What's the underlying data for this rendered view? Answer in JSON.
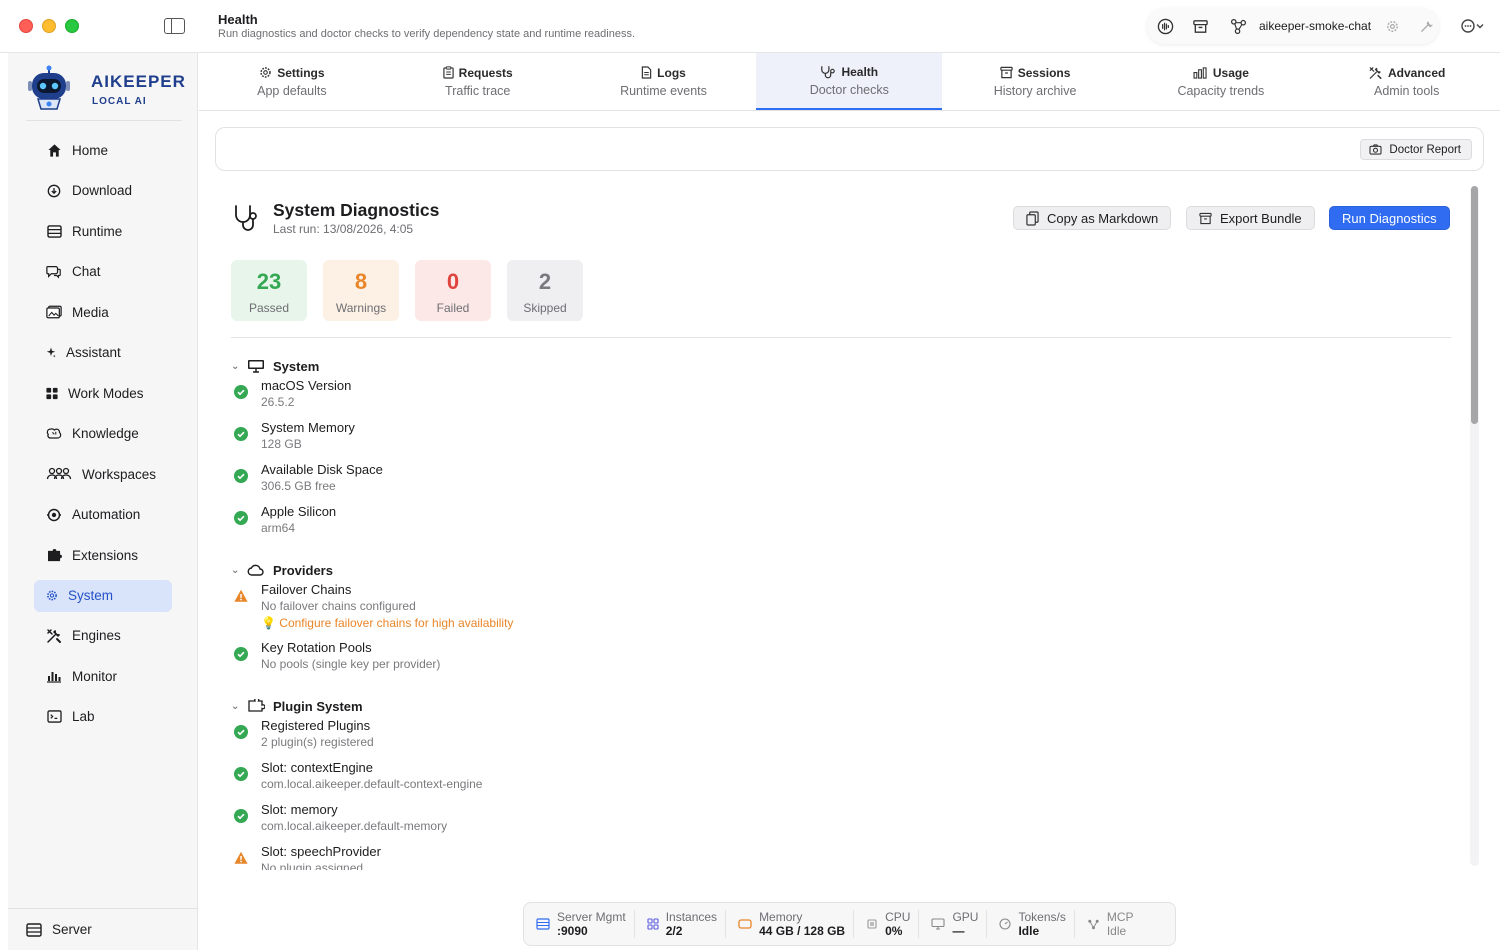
{
  "window": {
    "title": "Health",
    "subtitle": "Run diagnostics and doctor checks to verify dependency state and runtime readiness."
  },
  "toolbar": {
    "model_name": "aikeeper-smoke-chat"
  },
  "brand": {
    "name": "AIKEEPER",
    "sub": "LOCAL AI"
  },
  "sidebar": {
    "items": [
      {
        "label": "Home",
        "icon": "home-icon"
      },
      {
        "label": "Download",
        "icon": "download-icon"
      },
      {
        "label": "Runtime",
        "icon": "runtime-icon"
      },
      {
        "label": "Chat",
        "icon": "chat-icon"
      },
      {
        "label": "Media",
        "icon": "media-icon"
      },
      {
        "label": "Assistant",
        "icon": "sparkle-icon"
      },
      {
        "label": "Work Modes",
        "icon": "grid-icon"
      },
      {
        "label": "Knowledge",
        "icon": "brain-icon"
      },
      {
        "label": "Workspaces",
        "icon": "people-icon"
      },
      {
        "label": "Automation",
        "icon": "automation-icon"
      },
      {
        "label": "Extensions",
        "icon": "puzzle-icon"
      },
      {
        "label": "System",
        "icon": "gear-icon"
      },
      {
        "label": "Engines",
        "icon": "wrench-icon"
      },
      {
        "label": "Monitor",
        "icon": "chart-icon"
      },
      {
        "label": "Lab",
        "icon": "terminal-icon"
      }
    ],
    "active": "System",
    "footer_label": "Server"
  },
  "tabs": [
    {
      "label": "Settings",
      "sub": "App defaults",
      "icon": "gear-icon"
    },
    {
      "label": "Requests",
      "sub": "Traffic trace",
      "icon": "clipboard-icon"
    },
    {
      "label": "Logs",
      "sub": "Runtime events",
      "icon": "document-icon"
    },
    {
      "label": "Health",
      "sub": "Doctor checks",
      "icon": "stethoscope-icon"
    },
    {
      "label": "Sessions",
      "sub": "History archive",
      "icon": "archive-icon"
    },
    {
      "label": "Usage",
      "sub": "Capacity trends",
      "icon": "bar-chart-icon"
    },
    {
      "label": "Advanced",
      "sub": "Admin tools",
      "icon": "tools-icon"
    }
  ],
  "active_tab": "Health",
  "report_button": "Doctor Report",
  "diagnostics": {
    "title": "System Diagnostics",
    "last_run": "Last run: 13/08/2026, 4:05",
    "copy_button": "Copy as Markdown",
    "export_button": "Export Bundle",
    "run_button": "Run Diagnostics"
  },
  "stats": {
    "passed": {
      "value": "23",
      "label": "Passed"
    },
    "warnings": {
      "value": "8",
      "label": "Warnings"
    },
    "failed": {
      "value": "0",
      "label": "Failed"
    },
    "skipped": {
      "value": "2",
      "label": "Skipped"
    }
  },
  "colors": {
    "accent": "#2f6cf2",
    "pass": "#34a853",
    "warn": "#e8862a",
    "fail": "#e0443e"
  },
  "sections": {
    "system": {
      "title": "System",
      "checks": [
        {
          "name": "macOS Version",
          "detail": "26.5.2",
          "status": "pass"
        },
        {
          "name": "System Memory",
          "detail": "128 GB",
          "status": "pass"
        },
        {
          "name": "Available Disk Space",
          "detail": "306.5 GB free",
          "status": "pass"
        },
        {
          "name": "Apple Silicon",
          "detail": "arm64",
          "status": "pass"
        }
      ]
    },
    "providers": {
      "title": "Providers",
      "checks": [
        {
          "name": "Failover Chains",
          "detail": "No failover chains configured",
          "hint": "Configure failover chains for high availability",
          "status": "warn"
        },
        {
          "name": "Key Rotation Pools",
          "detail": "No pools (single key per provider)",
          "status": "pass"
        }
      ]
    },
    "plugins": {
      "title": "Plugin System",
      "checks": [
        {
          "name": "Registered Plugins",
          "detail": "2 plugin(s) registered",
          "status": "pass"
        },
        {
          "name": "Slot: contextEngine",
          "detail": "com.local.aikeeper.default-context-engine",
          "status": "pass"
        },
        {
          "name": "Slot: memory",
          "detail": "com.local.aikeeper.default-memory",
          "status": "pass"
        },
        {
          "name": "Slot: speechProvider",
          "detail": "No plugin assigned",
          "status": "warn"
        }
      ]
    }
  },
  "statusbar": {
    "server": {
      "label": "Server Mgmt",
      "value": ":9090"
    },
    "instances": {
      "label": "Instances",
      "value": "2/2"
    },
    "memory": {
      "label": "Memory",
      "value": "44 GB / 128 GB"
    },
    "cpu": {
      "label": "CPU",
      "value": "0%"
    },
    "gpu": {
      "label": "GPU",
      "value": "—"
    },
    "tokens": {
      "label": "Tokens/s",
      "value": "Idle"
    },
    "mcp": {
      "label": "MCP",
      "value": "Idle"
    }
  }
}
